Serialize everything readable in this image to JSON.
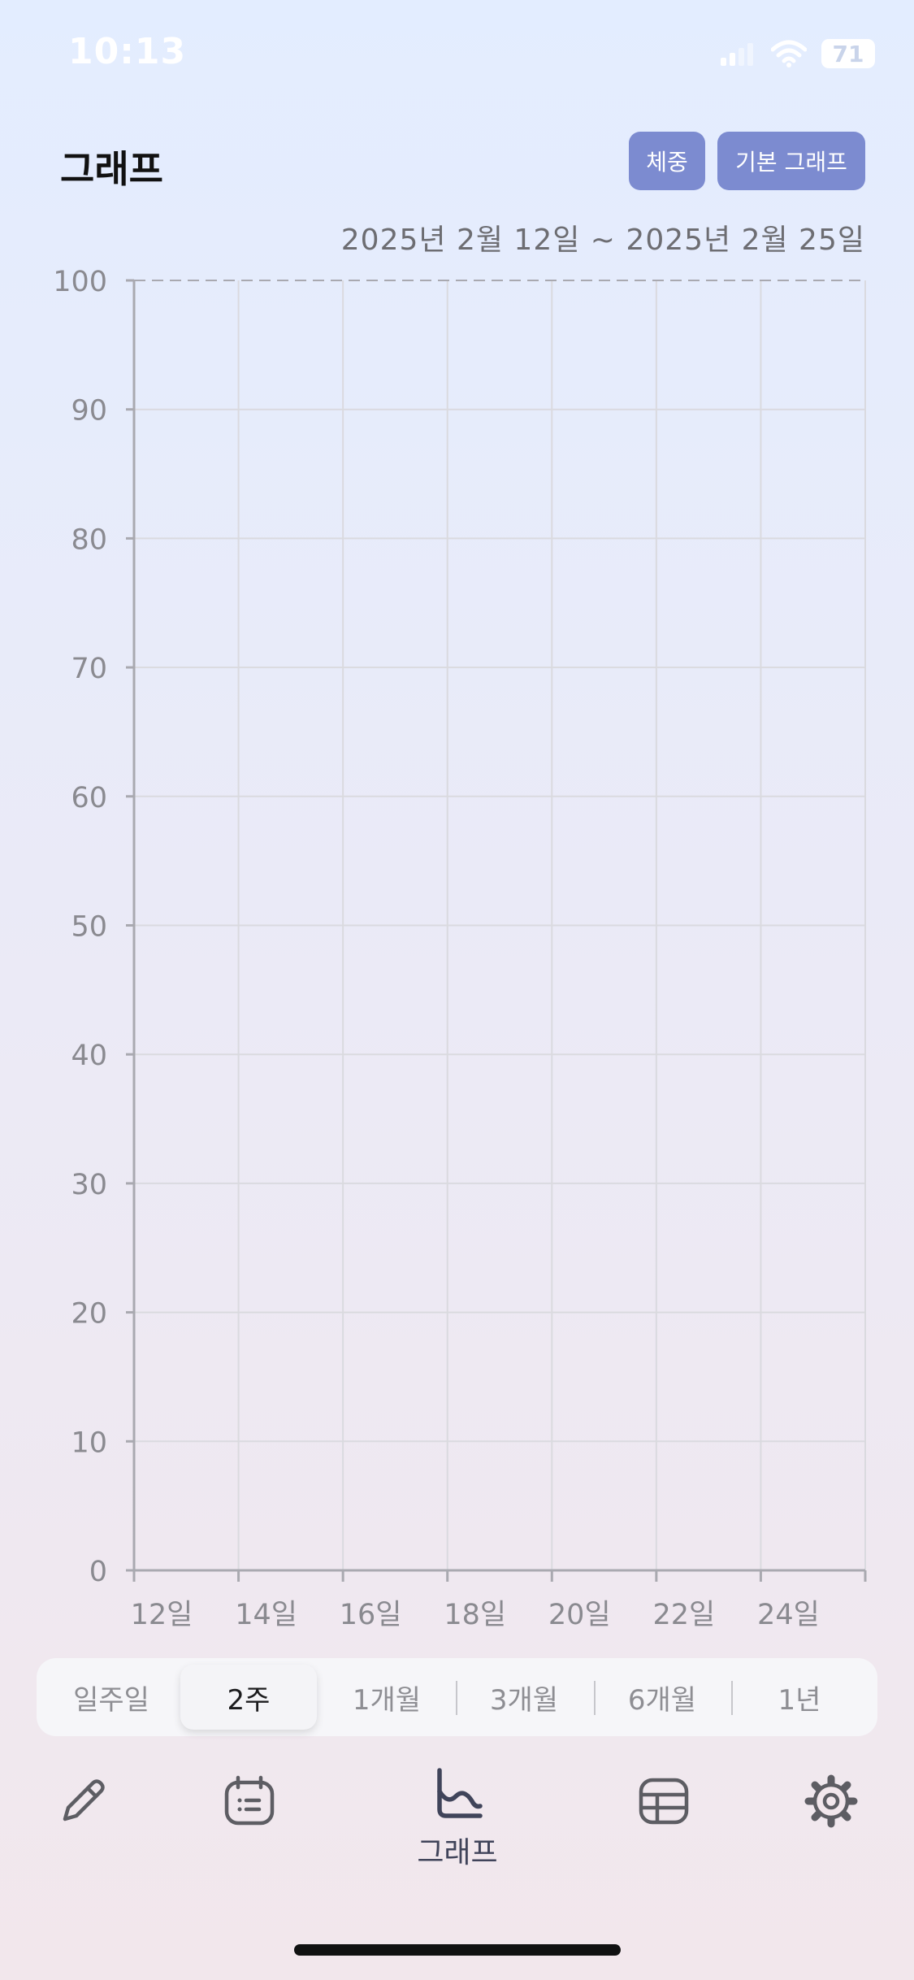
{
  "status_bar": {
    "time": "10:13",
    "battery": "71"
  },
  "header": {
    "title": "그래프",
    "buttons": {
      "weight": "체중",
      "graph_type": "기본 그래프"
    }
  },
  "date_range": "2025년 2월 12일 ~ 2025년 2월 25일",
  "chart_data": {
    "type": "line",
    "title": "",
    "xlabel": "",
    "ylabel": "",
    "ylim": [
      0,
      100
    ],
    "y_ticks": [
      0,
      10,
      20,
      30,
      40,
      50,
      60,
      70,
      80,
      90,
      100
    ],
    "x_range": [
      12,
      26
    ],
    "x_tick_values": [
      12,
      14,
      16,
      18,
      20,
      22,
      24
    ],
    "x_tick_labels": [
      "12일",
      "14일",
      "16일",
      "18일",
      "20일",
      "22일",
      "24일"
    ],
    "grid": true,
    "series": []
  },
  "period_selector": {
    "options": [
      "일주일",
      "2주",
      "1개월",
      "3개월",
      "6개월",
      "1년"
    ],
    "selected": "2주"
  },
  "tab_bar": {
    "items": [
      {
        "id": "record",
        "icon": "pencil-icon"
      },
      {
        "id": "calendar",
        "icon": "calendar-icon"
      },
      {
        "id": "graph",
        "icon": "graph-icon",
        "label": "그래프",
        "active": true
      },
      {
        "id": "table",
        "icon": "table-icon"
      },
      {
        "id": "settings",
        "icon": "gear-icon"
      }
    ]
  },
  "colors": {
    "accent": "#7c8bd0",
    "grid": "#dadadf",
    "axis": "#a9a9b0",
    "tick_text": "#8a8a90",
    "tab_icon": "#5d5d63",
    "tab_active": "#40445a"
  }
}
